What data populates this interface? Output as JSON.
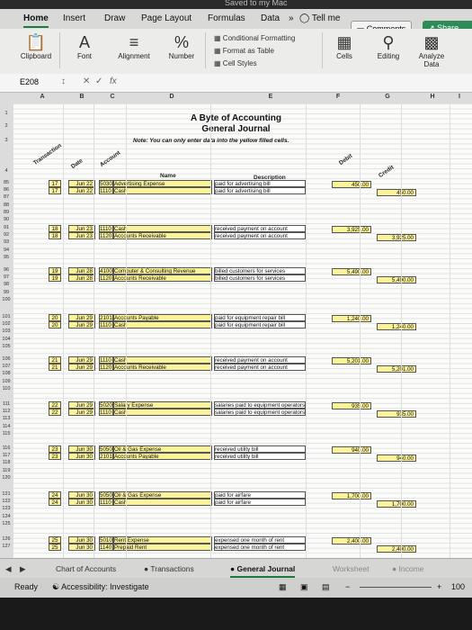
{
  "window": {
    "title": "Saved to my Mac"
  },
  "ribbon": {
    "tabs": [
      "Home",
      "Insert",
      "Draw",
      "Page Layout",
      "Formulas",
      "Data",
      "Tell me"
    ],
    "more_tabs": "»",
    "comments_label": "Comments",
    "share_label": "Share",
    "groups": {
      "clipboard": "Clipboard",
      "font": "Font",
      "font_glyph": "A",
      "alignment": "Alignment",
      "number": "Number",
      "number_glyph": "%",
      "conditional_formatting": "Conditional Formatting",
      "format_as_table": "Format as Table",
      "cell_styles": "Cell Styles",
      "cells": "Cells",
      "editing": "Editing",
      "analyze_data": "Analyze Data"
    }
  },
  "formula_bar": {
    "name_box": "E208",
    "fx": "fx",
    "formula": ""
  },
  "columns": [
    "A",
    "B",
    "C",
    "D",
    "E",
    "F",
    "G",
    "H",
    "I"
  ],
  "sheet": {
    "title": "A Byte of Accounting",
    "subtitle": "General Journal",
    "note": "Note: You can only enter data into the yellow filled cells.",
    "headers": {
      "transaction": "Transaction",
      "date": "Date",
      "account": "Account",
      "name": "Name",
      "description": "Description",
      "debit": "Debit",
      "credit": "Credit"
    },
    "row_numbers_top": [
      "1",
      "2",
      "3",
      "4"
    ],
    "entries": [
      {
        "rows": [
          "85",
          "86",
          "87",
          "88",
          "89",
          "90"
        ],
        "txn": "17",
        "date": "Jun 22",
        "dr_acct": "5030",
        "dr_name": "Advertising Expense",
        "cr_acct": "1110",
        "cr_name": "Cash",
        "desc": "paid for advertising bill",
        "amount": "450.00"
      },
      {
        "rows": [
          "91",
          "92",
          "93",
          "94",
          "95"
        ],
        "txn": "18",
        "date": "Jun 23",
        "dr_acct": "1110",
        "dr_name": "Cash",
        "cr_acct": "1120",
        "cr_name": "Accounts Receivable",
        "desc": "received payment on account",
        "amount": "3,925.00"
      },
      {
        "rows": [
          "96",
          "97",
          "98",
          "99",
          "100"
        ],
        "txn": "19",
        "date": "Jun 28",
        "dr_acct": "4100",
        "dr_name": "Computer & Consulting Revenue",
        "cr_acct": "1120",
        "cr_name": "Accounts Receivable",
        "desc": "billed customers for services",
        "amount": "5,490.00"
      },
      {
        "rows": [
          "101",
          "102",
          "103",
          "104",
          "105"
        ],
        "txn": "20",
        "date": "Jun 29",
        "dr_acct": "2101",
        "dr_name": "Accounts Payable",
        "cr_acct": "1110",
        "cr_name": "Cash",
        "desc": "paid for equipment repair bill",
        "amount": "1,240.00"
      },
      {
        "rows": [
          "106",
          "107",
          "108",
          "109",
          "110"
        ],
        "txn": "21",
        "date": "Jun 29",
        "dr_acct": "1110",
        "dr_name": "Cash",
        "cr_acct": "1120",
        "cr_name": "Accounts Receivable",
        "desc": "received payment on account",
        "amount": "5,201.00"
      },
      {
        "rows": [
          "111",
          "112",
          "113",
          "114",
          "115"
        ],
        "txn": "22",
        "date": "Jun 29",
        "dr_acct": "5020",
        "dr_name": "Salary Expense",
        "cr_acct": "1110",
        "cr_name": "Cash",
        "desc": "salaries paid to equipment operators",
        "amount": "935.00"
      },
      {
        "rows": [
          "116",
          "117",
          "118",
          "119",
          "120"
        ],
        "txn": "23",
        "date": "Jun 30",
        "dr_acct": "5050",
        "dr_name": "Oil & Gas Expense",
        "cr_acct": "2101",
        "cr_name": "Accounts Payable",
        "desc": "received utility bill",
        "amount": "940.00"
      },
      {
        "rows": [
          "121",
          "122",
          "123",
          "124",
          "125"
        ],
        "txn": "24",
        "date": "Jun 30",
        "dr_acct": "5050",
        "dr_name": "Oil & Gas Expense",
        "cr_acct": "1110",
        "cr_name": "Cash",
        "desc": "paid for airfare",
        "amount": "1,700.00"
      },
      {
        "rows": [
          "126",
          "127"
        ],
        "txn": "25",
        "date": "Jun 30",
        "dr_acct": "5010",
        "dr_name": "Rent Expense",
        "cr_acct": "1140",
        "cr_name": "Prepaid Rent",
        "desc": "expensed one month of rent",
        "amount": "2,400.00"
      }
    ]
  },
  "sheet_tabs": [
    "Chart of Accounts",
    "Transactions",
    "General Journal",
    "Worksheet",
    "Income"
  ],
  "active_sheet": "General Journal",
  "status": {
    "ready": "Ready",
    "accessibility": "Accessibility: Investigate",
    "zoom": "100"
  }
}
